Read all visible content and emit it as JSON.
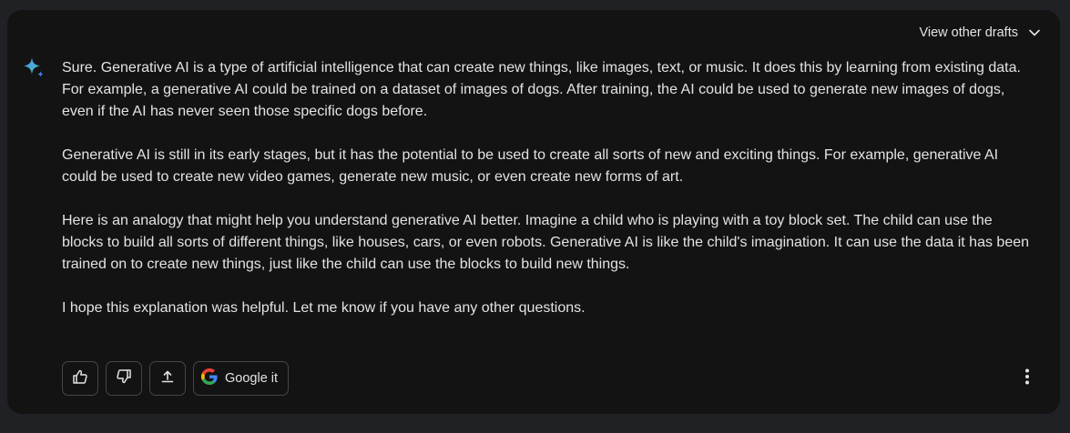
{
  "header": {
    "drafts_label": "View other drafts",
    "drafts_icon": "chevron-down-icon"
  },
  "assistant": {
    "icon": "sparkle-icon",
    "paragraphs": [
      "Sure. Generative AI is a type of artificial intelligence that can create new things, like images, text, or music. It does this by learning from existing data. For example, a generative AI could be trained on a dataset of images of dogs. After training, the AI could be used to generate new images of dogs, even if the AI has never seen those specific dogs before.",
      "Generative AI is still in its early stages, but it has the potential to be used to create all sorts of new and exciting things. For example, generative AI could be used to create new video games, generate new music, or even create new forms of art.",
      "Here is an analogy that might help you understand generative AI better. Imagine a child who is playing with a toy block set. The child can use the blocks to build all sorts of different things, like houses, cars, or even robots. Generative AI is like the child's imagination. It can use the data it has been trained on to create new things, just like the child can use the blocks to build new things.",
      "I hope this explanation was helpful. Let me know if you have any other questions."
    ]
  },
  "actions": {
    "thumbs_up_icon": "thumbs-up-icon",
    "thumbs_down_icon": "thumbs-down-icon",
    "share_icon": "share-icon",
    "google_icon": "google-g-icon",
    "google_label": "Google it",
    "more_icon": "more-vertical-icon"
  },
  "colors": {
    "page_background": "#202124",
    "card_background": "#131314",
    "text": "#e3e3e3",
    "button_border": "#444746",
    "sparkle_blue": "#4f8ff7",
    "sparkle_teal": "#41c4b4"
  }
}
